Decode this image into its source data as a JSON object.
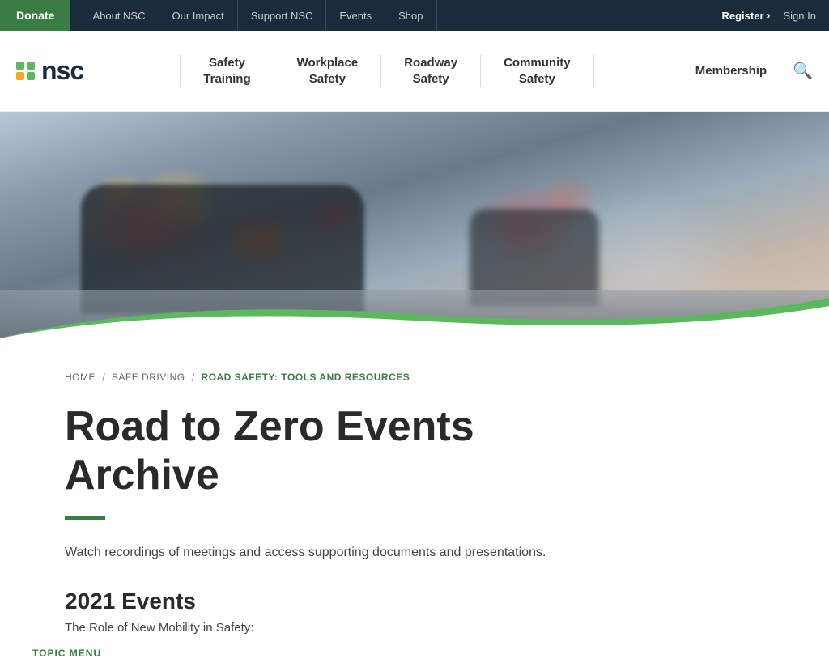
{
  "topbar": {
    "donate_label": "Donate",
    "nav_items": [
      {
        "label": "About NSC",
        "href": "#"
      },
      {
        "label": "Our Impact",
        "href": "#"
      },
      {
        "label": "Support NSC",
        "href": "#"
      },
      {
        "label": "Events",
        "href": "#"
      },
      {
        "label": "Shop",
        "href": "#"
      }
    ],
    "register_label": "Register",
    "register_arrow": "›",
    "signin_label": "Sign In"
  },
  "mainnav": {
    "logo_text": "nsc",
    "items": [
      {
        "label": "Safety\nTraining"
      },
      {
        "label": "Workplace\nSafety"
      },
      {
        "label": "Roadway\nSafety"
      },
      {
        "label": "Community\nSafety"
      }
    ],
    "membership_label": "Membership"
  },
  "breadcrumb": {
    "home": "HOME",
    "sep1": "/",
    "safe_driving": "SAFE DRIVING",
    "sep2": "/",
    "current": "ROAD SAFETY: TOOLS AND RESOURCES"
  },
  "page": {
    "title_line1": "Road to Zero Events",
    "title_line2": "Archive",
    "description": "Watch recordings of meetings and access supporting documents and presentations.",
    "events_year": "2021 Events",
    "events_teaser": "The Role of New Mobility in Safety:"
  },
  "sidebar": {
    "topic_menu_label": "TOPIC MENU"
  }
}
